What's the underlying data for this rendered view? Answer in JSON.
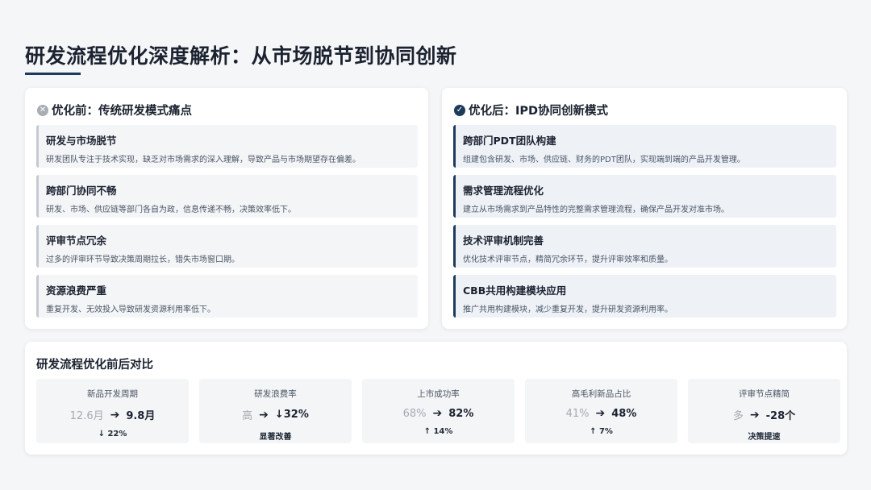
{
  "page_title": "研发流程优化深度解析：从市场脱节到协同创新",
  "before": {
    "icon": "x-circle-icon",
    "icon_glyph": "✕",
    "title": "优化前：传统研发模式痛点",
    "items": [
      {
        "title": "研发与市场脱节",
        "desc": "研发团队专注于技术实现，缺乏对市场需求的深入理解，导致产品与市场期望存在偏差。"
      },
      {
        "title": "跨部门协同不畅",
        "desc": "研发、市场、供应链等部门各自为政，信息传递不畅，决策效率低下。"
      },
      {
        "title": "评审节点冗余",
        "desc": "过多的评审环节导致决策周期拉长，错失市场窗口期。"
      },
      {
        "title": "资源浪费严重",
        "desc": "重复开发、无效投入导致研发资源利用率低下。"
      }
    ]
  },
  "after": {
    "icon": "check-circle-icon",
    "icon_glyph": "✓",
    "title": "优化后：IPD协同创新模式",
    "items": [
      {
        "title": "跨部门PDT团队构建",
        "desc": "组建包含研发、市场、供应链、财务的PDT团队，实现端到端的产品开发管理。"
      },
      {
        "title": "需求管理流程优化",
        "desc": "建立从市场需求到产品特性的完整需求管理流程，确保产品开发对准市场。"
      },
      {
        "title": "技术评审机制完善",
        "desc": "优化技术评审节点，精简冗余环节，提升评审效率和质量。"
      },
      {
        "title": "CBB共用构建模块应用",
        "desc": "推广共用构建模块，减少重复开发，提升研发资源利用率。"
      }
    ]
  },
  "comparison": {
    "title": "研发流程优化前后对比",
    "arrow_glyph": "➔",
    "metrics": [
      {
        "label": "新品开发周期",
        "before": "12.6月",
        "after": "9.8月",
        "change": "↓ 22%"
      },
      {
        "label": "研发浪费率",
        "before": "高",
        "after": "↓32%",
        "change": "显著改善"
      },
      {
        "label": "上市成功率",
        "before": "68%",
        "after": "82%",
        "change": "↑ 14%"
      },
      {
        "label": "高毛利新品占比",
        "before": "41%",
        "after": "48%",
        "change": "↑ 7%"
      },
      {
        "label": "评审节点精简",
        "before": "多",
        "after": "-28个",
        "change": "决策提速"
      }
    ]
  },
  "colors": {
    "accent": "#1f3b5c",
    "muted": "#a4aab3"
  }
}
